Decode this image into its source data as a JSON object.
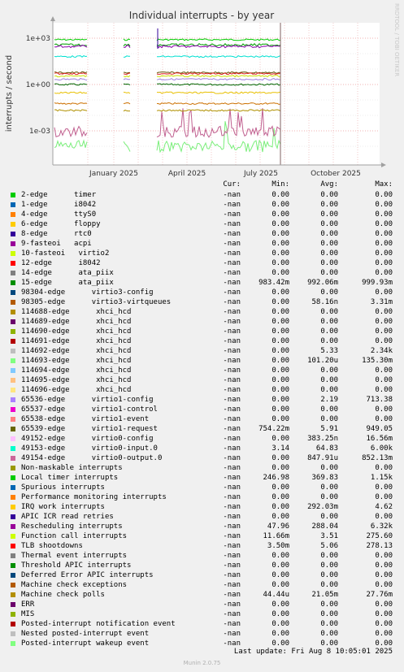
{
  "chart_data": {
    "type": "line",
    "title": "Individual interrupts - by year",
    "ylabel": "interrupts / second",
    "watermark": "RRDTOOL / TOBI OETIKER",
    "y_scale": "log",
    "yticks": [
      "1e-03",
      "1e+00",
      "1e+03"
    ],
    "xticks": [
      "January 2025",
      "April 2025",
      "July 2025",
      "October 2025"
    ],
    "grid": true,
    "series_note": "most traces are flat at their average rate; gaps where no data was collected",
    "series": [
      {
        "name": "2-edge timer",
        "color": "#00cc00",
        "level": 800
      },
      {
        "name": "15-edge ata_piix",
        "color": "#006600",
        "level": 1.0
      },
      {
        "name": "98305-edge virtio3-virtqueues",
        "color": "#cc7000",
        "level": 0.0582
      },
      {
        "name": "114693-edge xhci_hcd",
        "color": "#7aee7a",
        "level": 0.0001
      },
      {
        "name": "65536-edge virtio1-config",
        "color": "#a080e0",
        "level": 2.19
      },
      {
        "name": "65539-edge virtio1-request",
        "color": "#605000",
        "level": 5.91
      },
      {
        "name": "49153-edge virtio0-input.0",
        "color": "#00e0d0",
        "level": 64.83
      },
      {
        "name": "49154-edge virtio0-output.0",
        "color": "#c06090",
        "level": 0.000848
      },
      {
        "name": "Local timer interrupts",
        "color": "#00a000",
        "level": 369.83
      },
      {
        "name": "IRQ work interrupts",
        "color": "#e8c000",
        "level": 0.292
      },
      {
        "name": "Rescheduling interrupts",
        "color": "#8800aa",
        "level": 288.04
      },
      {
        "name": "Function call interrupts",
        "color": "#c8e000",
        "level": 3.51
      },
      {
        "name": "TLB shootdowns",
        "color": "#e02020",
        "level": 5.06
      },
      {
        "name": "Machine check polls",
        "color": "#b09000",
        "level": 0.021
      }
    ]
  },
  "legend": {
    "headers": {
      "cur": "Cur:",
      "min": "Min:",
      "avg": "Avg:",
      "max": "Max:"
    },
    "rows": [
      {
        "label": "2-edge      timer",
        "color": "#00cc00",
        "cur": "-nan",
        "min": "0.00",
        "avg": "0.00",
        "max": "0.00"
      },
      {
        "label": "1-edge      i8042",
        "color": "#0066b3",
        "cur": "-nan",
        "min": "0.00",
        "avg": "0.00",
        "max": "0.00"
      },
      {
        "label": "4-edge      ttyS0",
        "color": "#ff8000",
        "cur": "-nan",
        "min": "0.00",
        "avg": "0.00",
        "max": "0.00"
      },
      {
        "label": "6-edge      floppy",
        "color": "#ffcc00",
        "cur": "-nan",
        "min": "0.00",
        "avg": "0.00",
        "max": "0.00"
      },
      {
        "label": "8-edge      rtc0",
        "color": "#330099",
        "cur": "-nan",
        "min": "0.00",
        "avg": "0.00",
        "max": "0.00"
      },
      {
        "label": "9-fasteoi   acpi",
        "color": "#990099",
        "cur": "-nan",
        "min": "0.00",
        "avg": "0.00",
        "max": "0.00"
      },
      {
        "label": "10-fasteoi   virtio2",
        "color": "#ccff00",
        "cur": "-nan",
        "min": "0.00",
        "avg": "0.00",
        "max": "0.00"
      },
      {
        "label": "12-edge      i8042",
        "color": "#ff0000",
        "cur": "-nan",
        "min": "0.00",
        "avg": "0.00",
        "max": "0.00"
      },
      {
        "label": "14-edge      ata_piix",
        "color": "#808080",
        "cur": "-nan",
        "min": "0.00",
        "avg": "0.00",
        "max": "0.00"
      },
      {
        "label": "15-edge      ata_piix",
        "color": "#008f00",
        "cur": "-nan",
        "min": "983.42m",
        "avg": "992.06m",
        "max": "999.93m"
      },
      {
        "label": "98304-edge      virtio3-config",
        "color": "#00487d",
        "cur": "-nan",
        "min": "0.00",
        "avg": "0.00",
        "max": "0.00"
      },
      {
        "label": "98305-edge      virtio3-virtqueues",
        "color": "#b35a00",
        "cur": "-nan",
        "min": "0.00",
        "avg": "58.16n",
        "max": "3.31m"
      },
      {
        "label": "114688-edge      xhci_hcd",
        "color": "#b38f00",
        "cur": "-nan",
        "min": "0.00",
        "avg": "0.00",
        "max": "0.00"
      },
      {
        "label": "114689-edge      xhci_hcd",
        "color": "#6b006b",
        "cur": "-nan",
        "min": "0.00",
        "avg": "0.00",
        "max": "0.00"
      },
      {
        "label": "114690-edge      xhci_hcd",
        "color": "#8fb300",
        "cur": "-nan",
        "min": "0.00",
        "avg": "0.00",
        "max": "0.00"
      },
      {
        "label": "114691-edge      xhci_hcd",
        "color": "#b30000",
        "cur": "-nan",
        "min": "0.00",
        "avg": "0.00",
        "max": "0.00"
      },
      {
        "label": "114692-edge      xhci_hcd",
        "color": "#bebebe",
        "cur": "-nan",
        "min": "0.00",
        "avg": "5.33",
        "max": "2.34k"
      },
      {
        "label": "114693-edge      xhci_hcd",
        "color": "#80ff80",
        "cur": "-nan",
        "min": "0.00",
        "avg": "101.20u",
        "max": "135.30m"
      },
      {
        "label": "114694-edge      xhci_hcd",
        "color": "#80c9ff",
        "cur": "-nan",
        "min": "0.00",
        "avg": "0.00",
        "max": "0.00"
      },
      {
        "label": "114695-edge      xhci_hcd",
        "color": "#ffc080",
        "cur": "-nan",
        "min": "0.00",
        "avg": "0.00",
        "max": "0.00"
      },
      {
        "label": "114696-edge      xhci_hcd",
        "color": "#ffe680",
        "cur": "-nan",
        "min": "0.00",
        "avg": "0.00",
        "max": "0.00"
      },
      {
        "label": "65536-edge      virtio1-config",
        "color": "#aa80ff",
        "cur": "-nan",
        "min": "0.00",
        "avg": "2.19",
        "max": "713.38"
      },
      {
        "label": "65537-edge      virtio1-control",
        "color": "#ee00cc",
        "cur": "-nan",
        "min": "0.00",
        "avg": "0.00",
        "max": "0.00"
      },
      {
        "label": "65538-edge      virtio1-event",
        "color": "#ff8080",
        "cur": "-nan",
        "min": "0.00",
        "avg": "0.00",
        "max": "0.00"
      },
      {
        "label": "65539-edge      virtio1-request",
        "color": "#666600",
        "cur": "-nan",
        "min": "754.22m",
        "avg": "5.91",
        "max": "949.05"
      },
      {
        "label": "49152-edge      virtio0-config",
        "color": "#ffbfff",
        "cur": "-nan",
        "min": "0.00",
        "avg": "383.25n",
        "max": "16.56m"
      },
      {
        "label": "49153-edge      virtio0-input.0",
        "color": "#00ffcc",
        "cur": "-nan",
        "min": "3.14",
        "avg": "64.83",
        "max": "6.00k"
      },
      {
        "label": "49154-edge      virtio0-output.0",
        "color": "#cc6699",
        "cur": "-nan",
        "min": "0.00",
        "avg": "847.91u",
        "max": "852.13m"
      },
      {
        "label": "Non-maskable interrupts",
        "color": "#999900",
        "cur": "-nan",
        "min": "0.00",
        "avg": "0.00",
        "max": "0.00"
      },
      {
        "label": "Local timer interrupts",
        "color": "#00cc00",
        "cur": "-nan",
        "min": "246.98",
        "avg": "369.83",
        "max": "1.15k"
      },
      {
        "label": "Spurious interrupts",
        "color": "#0066b3",
        "cur": "-nan",
        "min": "0.00",
        "avg": "0.00",
        "max": "0.00"
      },
      {
        "label": "Performance monitoring interrupts",
        "color": "#ff8000",
        "cur": "-nan",
        "min": "0.00",
        "avg": "0.00",
        "max": "0.00"
      },
      {
        "label": "IRQ work interrupts",
        "color": "#ffcc00",
        "cur": "-nan",
        "min": "0.00",
        "avg": "292.03m",
        "max": "4.62"
      },
      {
        "label": "APIC ICR read retries",
        "color": "#330099",
        "cur": "-nan",
        "min": "0.00",
        "avg": "0.00",
        "max": "0.00"
      },
      {
        "label": "Rescheduling interrupts",
        "color": "#990099",
        "cur": "-nan",
        "min": "47.96",
        "avg": "288.04",
        "max": "6.32k"
      },
      {
        "label": "Function call interrupts",
        "color": "#ccff00",
        "cur": "-nan",
        "min": "11.66m",
        "avg": "3.51",
        "max": "275.60"
      },
      {
        "label": "TLB shootdowns",
        "color": "#ff0000",
        "cur": "-nan",
        "min": "3.50m",
        "avg": "5.06",
        "max": "278.13"
      },
      {
        "label": "Thermal event interrupts",
        "color": "#808080",
        "cur": "-nan",
        "min": "0.00",
        "avg": "0.00",
        "max": "0.00"
      },
      {
        "label": "Threshold APIC interrupts",
        "color": "#008f00",
        "cur": "-nan",
        "min": "0.00",
        "avg": "0.00",
        "max": "0.00"
      },
      {
        "label": "Deferred Error APIC interrupts",
        "color": "#00487d",
        "cur": "-nan",
        "min": "0.00",
        "avg": "0.00",
        "max": "0.00"
      },
      {
        "label": "Machine check exceptions",
        "color": "#b35a00",
        "cur": "-nan",
        "min": "0.00",
        "avg": "0.00",
        "max": "0.00"
      },
      {
        "label": "Machine check polls",
        "color": "#b38f00",
        "cur": "-nan",
        "min": "44.44u",
        "avg": "21.05m",
        "max": "27.76m"
      },
      {
        "label": "ERR",
        "color": "#6b006b",
        "cur": "-nan",
        "min": "0.00",
        "avg": "0.00",
        "max": "0.00"
      },
      {
        "label": "MIS",
        "color": "#8fb300",
        "cur": "-nan",
        "min": "0.00",
        "avg": "0.00",
        "max": "0.00"
      },
      {
        "label": "Posted-interrupt notification event",
        "color": "#b30000",
        "cur": "-nan",
        "min": "0.00",
        "avg": "0.00",
        "max": "0.00"
      },
      {
        "label": "Nested posted-interrupt event",
        "color": "#bebebe",
        "cur": "-nan",
        "min": "0.00",
        "avg": "0.00",
        "max": "0.00"
      },
      {
        "label": "Posted-interrupt wakeup event",
        "color": "#80ff80",
        "cur": "-nan",
        "min": "0.00",
        "avg": "0.00",
        "max": "0.00"
      }
    ]
  },
  "last_update": "Last update: Fri Aug  8 10:05:01 2025",
  "footer": "Munin 2.0.75"
}
